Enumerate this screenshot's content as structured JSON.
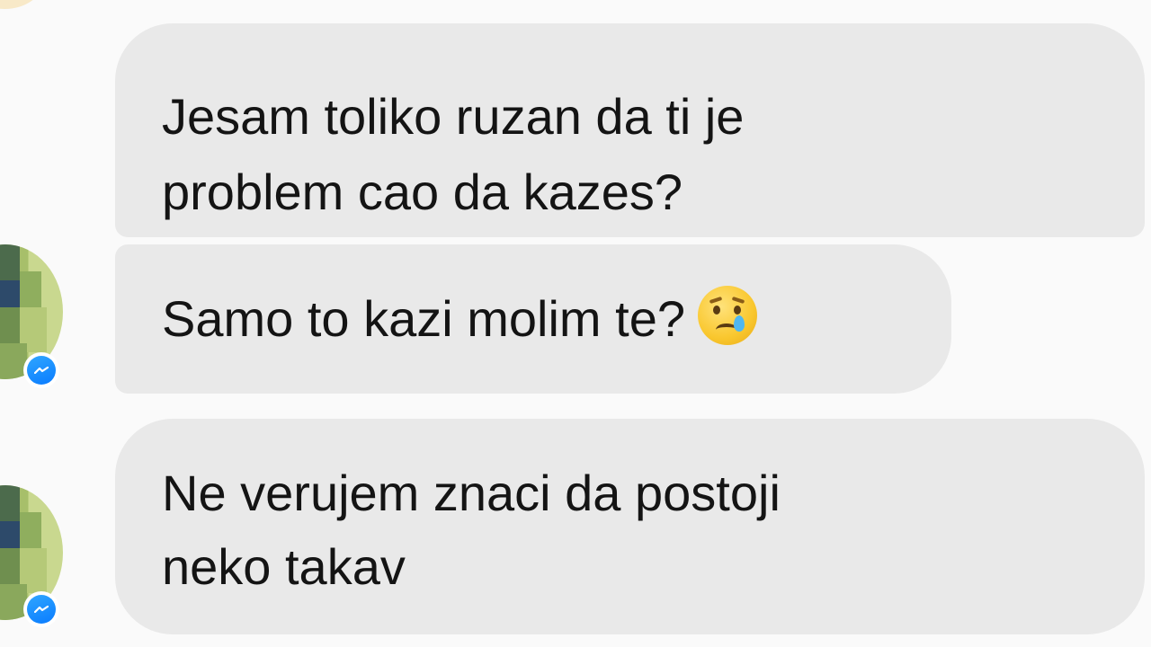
{
  "messages": [
    {
      "text_line1": "Jesam toliko ruzan da ti je",
      "text_line2": "problem cao da kazes?"
    },
    {
      "text": "Samo to kazi molim te?",
      "emoji": "crying-face"
    },
    {
      "text_line1": "Ne verujem znaci da postoji",
      "text_line2": "neko takav"
    }
  ],
  "colors": {
    "bubble_bg": "#e9e9e9",
    "text": "#141414",
    "messenger_blue": "#0a7cff",
    "background": "#fafafa"
  },
  "icons": [
    "messenger-icon",
    "crying-face-emoji"
  ]
}
